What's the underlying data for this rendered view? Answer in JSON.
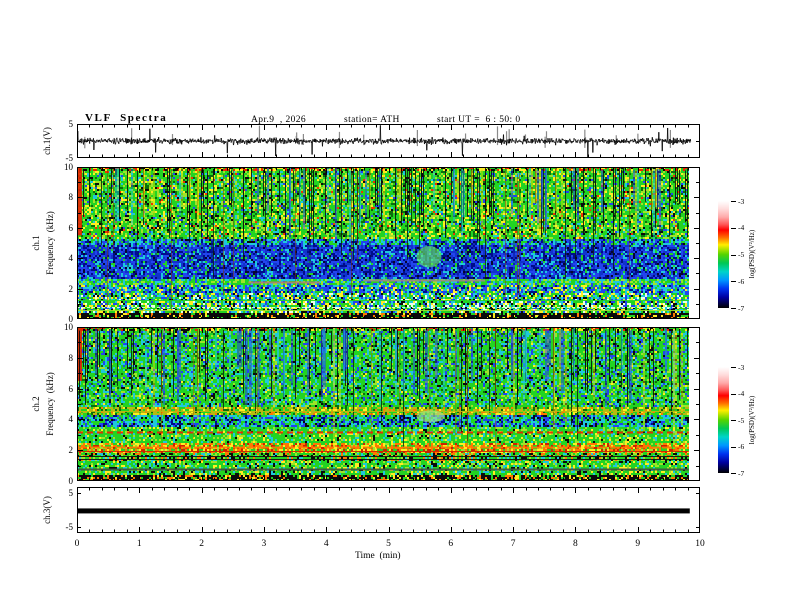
{
  "header": {
    "title": "VLF  Spectra",
    "date": "Apr.9  , 2026",
    "station": "station= ATH",
    "start_ut": "start UT =  6 : 50: 0"
  },
  "axes": {
    "time_label": "Time  (min)",
    "time_ticks": [
      "0",
      "1",
      "2",
      "3",
      "4",
      "5",
      "6",
      "7",
      "8",
      "9",
      "10"
    ],
    "freq_label": "Frequency  (kHz)",
    "freq_ticks": [
      "10",
      "8",
      "6",
      "4",
      "2",
      "0"
    ],
    "wave_ticks": [
      "5",
      "-5"
    ]
  },
  "panels": {
    "ch1_wave": {
      "label": "ch.1(V)"
    },
    "ch1_spec": {
      "label": "ch.1"
    },
    "ch2_spec": {
      "label": "ch.2"
    },
    "ch3_wave": {
      "label": "ch.3(V)"
    }
  },
  "colorbar": {
    "label": "log(PSD)(V²/Hz)",
    "ticks": [
      "-3",
      "-4",
      "-5",
      "-6",
      "-7"
    ],
    "gradient": [
      [
        0,
        "#ffffff"
      ],
      [
        0.07,
        "#ffdede"
      ],
      [
        0.15,
        "#ffaaaa"
      ],
      [
        0.22,
        "#ff5555"
      ],
      [
        0.27,
        "#ff0000"
      ],
      [
        0.34,
        "#ff6a00"
      ],
      [
        0.41,
        "#ffee00"
      ],
      [
        0.5,
        "#55d400"
      ],
      [
        0.58,
        "#00c855"
      ],
      [
        0.66,
        "#00d4c8"
      ],
      [
        0.74,
        "#0096ff"
      ],
      [
        0.82,
        "#0032f0"
      ],
      [
        0.9,
        "#0000a0"
      ],
      [
        1,
        "#000000"
      ]
    ]
  },
  "chart_data": [
    {
      "id": "ch1_wave",
      "type": "line",
      "title": "ch.1(V) waveform",
      "xlim": [
        0,
        10
      ],
      "ylim": [
        -5,
        5
      ],
      "baseline": 0,
      "noise_rms": 0.55,
      "spike_prob": 0.013,
      "spike_max": 3.6,
      "n_points": 1600,
      "data_end_min": 9.85,
      "ghost_spikes": 22,
      "line_color": "#000000",
      "ghost_color": "#8a8a8a",
      "seed": 7
    },
    {
      "id": "ch1_spec",
      "type": "heatmap",
      "title": "ch.1 VLF spectrogram",
      "xlim": [
        0,
        10
      ],
      "ylim": [
        0,
        10
      ],
      "data_end_min": 9.82,
      "seed": 11,
      "bands": [
        {
          "f": [
            9.7,
            10
          ],
          "palette": [
            [
              "#22cc22",
              0.4
            ],
            [
              "#ffee22",
              0.22
            ],
            [
              "#ee2200",
              0.2
            ],
            [
              "#0a0a0a",
              0.18
            ]
          ]
        },
        {
          "f": [
            5.3,
            9.7
          ],
          "palette": [
            [
              "#22d422",
              0.46
            ],
            [
              "#9fe32a",
              0.16
            ],
            [
              "#ffee22",
              0.1
            ],
            [
              "#1ec8dc",
              0.07
            ],
            [
              "#0c6e0c",
              0.09
            ],
            [
              "#0a0a0a",
              0.06
            ],
            [
              "#ee3300",
              0.02
            ],
            [
              "#2244ee",
              0.04
            ]
          ]
        },
        {
          "f": [
            4.9,
            5.3
          ],
          "palette": [
            [
              "#22d422",
              0.22
            ],
            [
              "#1ec8dc",
              0.3
            ],
            [
              "#2244ee",
              0.3
            ],
            [
              "#000d8a",
              0.12
            ],
            [
              "#0a0a0a",
              0.06
            ]
          ]
        },
        {
          "f": [
            2.6,
            4.9
          ],
          "palette": [
            [
              "#2244ee",
              0.3
            ],
            [
              "#1133cc",
              0.22
            ],
            [
              "#000d8a",
              0.2
            ],
            [
              "#1ec8dc",
              0.14
            ],
            [
              "#060630",
              0.07
            ],
            [
              "#22d422",
              0.07
            ]
          ]
        },
        {
          "f": [
            2.25,
            2.6
          ],
          "palette": [
            [
              "#22d422",
              0.42
            ],
            [
              "#9fe32a",
              0.2
            ],
            [
              "#1ec8dc",
              0.26
            ],
            [
              "#2244ee",
              0.12
            ]
          ]
        },
        {
          "f": [
            1.7,
            2.25
          ],
          "palette": [
            [
              "#2244ee",
              0.27
            ],
            [
              "#1ec8dc",
              0.24
            ],
            [
              "#22d422",
              0.2
            ],
            [
              "#000d8a",
              0.16
            ],
            [
              "#ffee22",
              0.13
            ]
          ]
        },
        {
          "f": [
            1.05,
            1.7
          ],
          "palette": [
            [
              "#22d422",
              0.27
            ],
            [
              "#ffee22",
              0.17
            ],
            [
              "#1ec8dc",
              0.2
            ],
            [
              "#2244ee",
              0.16
            ],
            [
              "#0a0a0a",
              0.11
            ],
            [
              "#eaffea",
              0.09
            ]
          ]
        },
        {
          "f": [
            0.45,
            1.05
          ],
          "palette": [
            [
              "#22d422",
              0.3
            ],
            [
              "#eaffea",
              0.12
            ],
            [
              "#ffee22",
              0.17
            ],
            [
              "#1ec8dc",
              0.16
            ],
            [
              "#0a0a0a",
              0.15
            ],
            [
              "#2244ee",
              0.1
            ]
          ]
        },
        {
          "f": [
            0,
            0.45
          ],
          "palette": [
            [
              "#0a0a0a",
              0.66
            ],
            [
              "#22d422",
              0.12
            ],
            [
              "#ff7700",
              0.11
            ],
            [
              "#ffee22",
              0.11
            ]
          ]
        }
      ],
      "vrects": [
        {
          "t": [
            0,
            0.08
          ],
          "f": [
            5.5,
            10
          ],
          "color": "#e62200"
        }
      ],
      "streaks": [
        {
          "count": 90,
          "f": [
            5.0,
            10
          ],
          "width": 1,
          "colors": [
            "#0a0a0a"
          ],
          "alpha": 0.85
        },
        {
          "count": 26,
          "f": [
            2.6,
            10
          ],
          "width": 1,
          "colors": [
            "#0a1a0a"
          ],
          "alpha": 0.8
        },
        {
          "count": 36,
          "f": [
            5.0,
            10
          ],
          "width": 2,
          "colors": [
            "#1ec8dc",
            "#2244ee"
          ],
          "alpha": 0.5
        },
        {
          "count": 30,
          "f": [
            2.6,
            5.2
          ],
          "width": 2,
          "colors": [
            "#000d8a"
          ],
          "alpha": 0.5
        },
        {
          "count": 22,
          "f": [
            5.3,
            10
          ],
          "width": 2,
          "colors": [
            "#ffe000",
            "#c8e000"
          ],
          "alpha": 0.5
        },
        {
          "count": 12,
          "f": [
            0,
            10
          ],
          "width": 1,
          "colors": [
            "#883300"
          ],
          "alpha": 0.5
        }
      ],
      "hlines": [
        {
          "f": 2.45,
          "t": [
            2.75,
            3.9
          ],
          "color": "#b08070",
          "w": 2
        },
        {
          "f": 2.55,
          "t": [
            4.6,
            6.55
          ],
          "color": "#9a8a80",
          "w": 2
        },
        {
          "f": 0.82,
          "t": [
            0,
            9.82
          ],
          "color": "#d8ffd8",
          "w": 1,
          "dash": [
            3,
            2
          ]
        },
        {
          "f": 0.6,
          "t": [
            0,
            9.82
          ],
          "color": "#9fe32a",
          "w": 1
        },
        {
          "f": 1.25,
          "t": [
            0,
            9.82
          ],
          "color": "#22d422",
          "w": 1
        }
      ],
      "blobs": [
        {
          "t": [
            5.45,
            5.85
          ],
          "f": [
            3.4,
            4.8
          ],
          "color": "#66ee66"
        }
      ]
    },
    {
      "id": "ch2_spec",
      "type": "heatmap",
      "title": "ch.2 VLF spectrogram",
      "xlim": [
        0,
        10
      ],
      "ylim": [
        0,
        10
      ],
      "data_end_min": 9.82,
      "seed": 23,
      "bands": [
        {
          "f": [
            9.8,
            10
          ],
          "palette": [
            [
              "#22cc22",
              0.45
            ],
            [
              "#ffee22",
              0.25
            ],
            [
              "#ee2200",
              0.15
            ],
            [
              "#0a0a0a",
              0.15
            ]
          ]
        },
        {
          "f": [
            4.8,
            9.8
          ],
          "palette": [
            [
              "#22d422",
              0.5
            ],
            [
              "#1ec8dc",
              0.17
            ],
            [
              "#9fe32a",
              0.1
            ],
            [
              "#2244ee",
              0.08
            ],
            [
              "#0c6e0c",
              0.07
            ],
            [
              "#0a0a0a",
              0.06
            ],
            [
              "#ffee22",
              0.02
            ]
          ]
        },
        {
          "f": [
            4.35,
            4.8
          ],
          "palette": [
            [
              "#b8b812",
              0.34
            ],
            [
              "#22d422",
              0.28
            ],
            [
              "#ffee22",
              0.14
            ],
            [
              "#ff7700",
              0.1
            ],
            [
              "#0c6e0c",
              0.14
            ]
          ]
        },
        {
          "f": [
            3.55,
            4.35
          ],
          "palette": [
            [
              "#22d422",
              0.3
            ],
            [
              "#1ec8dc",
              0.26
            ],
            [
              "#2244ee",
              0.22
            ],
            [
              "#000d8a",
              0.12
            ],
            [
              "#0a0a0a",
              0.1
            ]
          ]
        },
        {
          "f": [
            2.45,
            3.55
          ],
          "palette": [
            [
              "#22d422",
              0.6
            ],
            [
              "#1ec8dc",
              0.14
            ],
            [
              "#9fe32a",
              0.14
            ],
            [
              "#0a0a0a",
              0.05
            ],
            [
              "#ffee22",
              0.07
            ]
          ]
        },
        {
          "f": [
            1.85,
            2.45
          ],
          "palette": [
            [
              "#ff7700",
              0.25
            ],
            [
              "#ffee22",
              0.2
            ],
            [
              "#22d422",
              0.28
            ],
            [
              "#cc2200",
              0.15
            ],
            [
              "#9fe32a",
              0.12
            ]
          ]
        },
        {
          "f": [
            1.35,
            1.85
          ],
          "palette": [
            [
              "#22d422",
              0.4
            ],
            [
              "#0a0a0a",
              0.2
            ],
            [
              "#9fe32a",
              0.14
            ],
            [
              "#1ec8dc",
              0.12
            ],
            [
              "#ff7700",
              0.14
            ]
          ]
        },
        {
          "f": [
            0.35,
            1.35
          ],
          "palette": [
            [
              "#22d422",
              0.5
            ],
            [
              "#1ec8dc",
              0.16
            ],
            [
              "#0a0a0a",
              0.12
            ],
            [
              "#ffee22",
              0.12
            ],
            [
              "#9fe32a",
              0.1
            ]
          ]
        },
        {
          "f": [
            0,
            0.35
          ],
          "palette": [
            [
              "#0a0a0a",
              0.6
            ],
            [
              "#ff7700",
              0.14
            ],
            [
              "#22d422",
              0.14
            ],
            [
              "#ffee22",
              0.12
            ]
          ]
        }
      ],
      "vrects": [
        {
          "t": [
            0,
            0.08
          ],
          "f": [
            6.5,
            10
          ],
          "color": "#e62200"
        }
      ],
      "streaks": [
        {
          "count": 70,
          "f": [
            4.8,
            10
          ],
          "width": 1,
          "colors": [
            "#0a0a0a"
          ],
          "alpha": 0.85
        },
        {
          "count": 20,
          "f": [
            1.8,
            10
          ],
          "width": 1,
          "colors": [
            "#0a1a0a"
          ],
          "alpha": 0.8
        },
        {
          "count": 46,
          "f": [
            4.8,
            10
          ],
          "width": 2,
          "colors": [
            "#1ec8dc",
            "#2244ee"
          ],
          "alpha": 0.55
        },
        {
          "count": 12,
          "f": [
            4.8,
            10
          ],
          "width": 3,
          "colors": [
            "#2244ee"
          ],
          "alpha": 0.5
        },
        {
          "count": 14,
          "f": [
            1.8,
            10
          ],
          "width": 2,
          "colors": [
            "#ffe000"
          ],
          "alpha": 0.4
        },
        {
          "count": 10,
          "f": [
            0,
            10
          ],
          "width": 1,
          "colors": [
            "#aa6600"
          ],
          "alpha": 0.5
        }
      ],
      "hlines": [
        {
          "f": 3.15,
          "t": [
            0,
            9.82
          ],
          "color": "#ee2200",
          "w": 2,
          "dash": [
            6,
            4
          ]
        },
        {
          "f": 2.2,
          "t": [
            0,
            9.82
          ],
          "color": "#ff7700",
          "w": 2,
          "dash": [
            10,
            3
          ]
        },
        {
          "f": 1.95,
          "t": [
            0,
            9.82
          ],
          "color": "#cc2200",
          "w": 1
        },
        {
          "f": 1.6,
          "t": [
            0,
            9.82
          ],
          "color": "#101010",
          "w": 1
        },
        {
          "f": 1.45,
          "t": [
            0,
            9.82
          ],
          "color": "#101010",
          "w": 1
        },
        {
          "f": 0.75,
          "t": [
            0,
            9.82
          ],
          "color": "#405040",
          "w": 2
        },
        {
          "f": 4.55,
          "t": [
            0,
            9.82
          ],
          "color": "#b8b812",
          "w": 1
        }
      ],
      "blobs": [
        {
          "t": [
            5.45,
            5.9
          ],
          "f": [
            3.8,
            4.6
          ],
          "color": "#9fe88a"
        }
      ]
    },
    {
      "id": "ch3_wave",
      "type": "flatline",
      "title": "ch.3(V) waveform",
      "xlim": [
        0,
        10
      ],
      "ylim": [
        -5,
        5
      ],
      "value": 0,
      "thickness_px": 5,
      "data_end_min": 9.82,
      "line_color": "#000000"
    }
  ]
}
